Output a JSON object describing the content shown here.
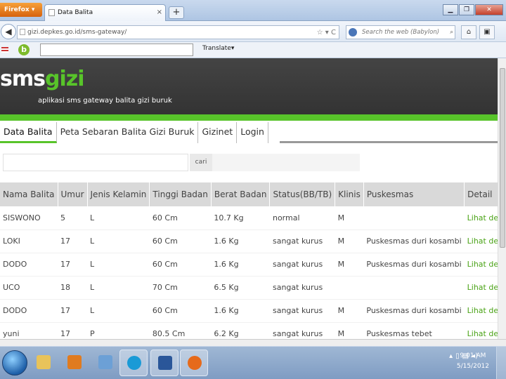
{
  "browser": {
    "menu_label": "Firefox ▾",
    "tab_title": "Data Balita",
    "url": "gizi.depkes.go.id/sms-gateway/",
    "search_placeholder": "Search the web (Babylon)",
    "translate_label": "Translate▾",
    "window_buttons": [
      "▁",
      "❐",
      "✕"
    ]
  },
  "site": {
    "brand_sms": "sms",
    "brand_gizi": "gizi",
    "tagline": "aplikasi sms gateway balita gizi buruk",
    "menu": [
      "Data Balita",
      "Peta Sebaran Balita Gizi Buruk",
      "Gizinet",
      "Login"
    ],
    "search_button": "cari"
  },
  "table": {
    "headers": [
      "Nama Balita",
      "Umur",
      "Jenis Kelamin",
      "Tinggi Badan",
      "Berat Badan",
      "Status(BB/TB)",
      "Klinis",
      "Puskesmas",
      "Detail"
    ],
    "rows": [
      [
        "SISWONO",
        "5",
        "L",
        "60 Cm",
        "10.7 Kg",
        "normal",
        "M",
        "",
        "Lihat detail"
      ],
      [
        "LOKI",
        "17",
        "L",
        "60 Cm",
        "1.6 Kg",
        "sangat kurus",
        "M",
        "Puskesmas duri kosambi",
        "Lihat detail"
      ],
      [
        "DODO",
        "17",
        "L",
        "60 Cm",
        "1.6 Kg",
        "sangat kurus",
        "M",
        "Puskesmas duri kosambi",
        "Lihat detail"
      ],
      [
        "UCO",
        "18",
        "L",
        "70 Cm",
        "6.5 Kg",
        "sangat kurus",
        "",
        "",
        "Lihat detail"
      ],
      [
        "DODO",
        "17",
        "L",
        "60 Cm",
        "1.6 Kg",
        "sangat kurus",
        "M",
        "Puskesmas duri kosambi",
        "Lihat detail"
      ],
      [
        "yuni",
        "17",
        "P",
        "80.5 Cm",
        "6.2 Kg",
        "sangat kurus",
        "M",
        "Puskesmas tebet",
        "Lihat detail"
      ]
    ]
  },
  "taskbar": {
    "time": "9:01 AM",
    "date": "5/15/2012"
  },
  "colors": {
    "brand_green": "#58c42a",
    "link_green": "#4aa316",
    "header_dark": "#3a3a3a"
  }
}
